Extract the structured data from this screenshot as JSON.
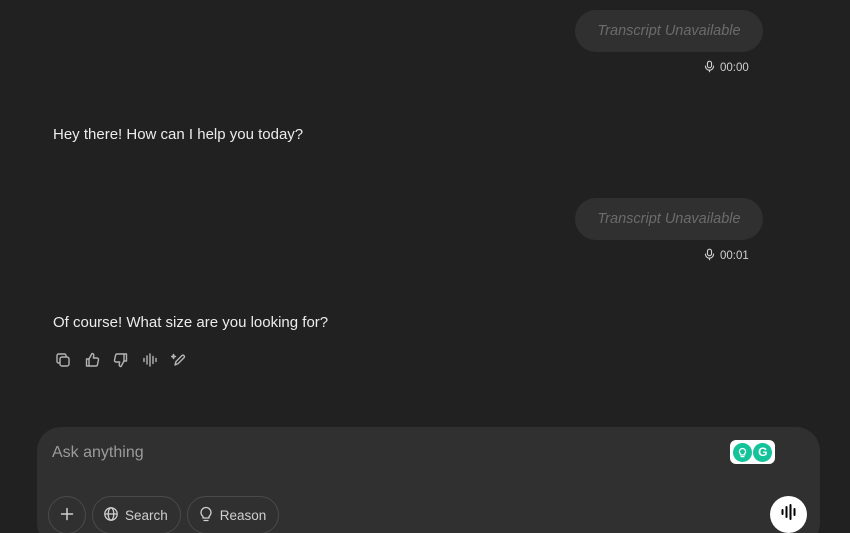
{
  "messages": [
    {
      "role": "user",
      "text": "Transcript Unavailable",
      "duration": "00:00"
    },
    {
      "role": "assistant",
      "text": "Hey there! How can I help you today?"
    },
    {
      "role": "user",
      "text": "Transcript Unavailable",
      "duration": "00:01"
    },
    {
      "role": "assistant",
      "text": "Of course! What size are you looking for?"
    }
  ],
  "message_actions": [
    "copy-icon",
    "thumbs-up-icon",
    "thumbs-down-icon",
    "read-aloud-icon",
    "edit-canvas-icon"
  ],
  "composer": {
    "placeholder": "Ask anything",
    "tools": {
      "attach_icon": "plus-icon",
      "search_label": "Search",
      "reason_label": "Reason"
    },
    "voice_icon": "voice-waveform-icon"
  },
  "extensions": {
    "first_icon": "lightbulb-icon",
    "grammarly_letter": "G"
  },
  "colors": {
    "background": "#212121",
    "bubble": "#303030",
    "composer": "#303030",
    "grammarly": "#15c39a"
  }
}
